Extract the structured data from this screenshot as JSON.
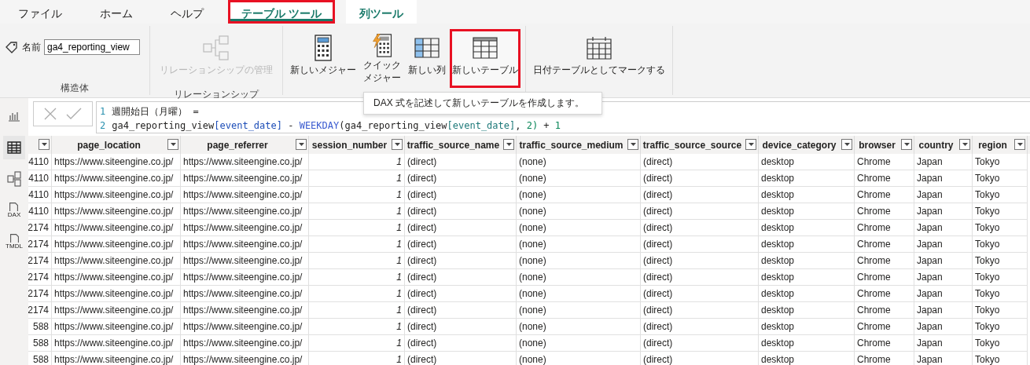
{
  "tabs": [
    {
      "label": "ファイル",
      "selected": false,
      "contextual": false,
      "highlighted": false
    },
    {
      "label": "ホーム",
      "selected": false,
      "contextual": false,
      "highlighted": false
    },
    {
      "label": "ヘルプ",
      "selected": false,
      "contextual": false,
      "highlighted": false
    },
    {
      "label": "テーブル ツール",
      "selected": true,
      "contextual": true,
      "highlighted": true
    },
    {
      "label": "列ツール",
      "selected": false,
      "contextual": true,
      "highlighted": false
    }
  ],
  "ribbon": {
    "groups": [
      {
        "label": "構造体",
        "items": [
          {
            "kind": "name_field",
            "label": "名前",
            "value": "ga4_reporting_view"
          }
        ]
      },
      {
        "label": "リレーションシップ",
        "items": [
          {
            "kind": "relationships",
            "label": "リレーションシップの管理",
            "disabled": true,
            "highlighted": false
          }
        ]
      },
      {
        "items": [
          {
            "kind": "measure",
            "label": "新しいメジャー",
            "disabled": false,
            "highlighted": false
          },
          {
            "kind": "quick_measure",
            "label": "クイックメジャー",
            "disabled": false,
            "highlighted": false
          },
          {
            "kind": "column",
            "label": "新しい列",
            "disabled": false,
            "highlighted": false
          },
          {
            "kind": "table",
            "label": "新しいテーブル",
            "disabled": false,
            "highlighted": true
          }
        ]
      },
      {
        "items": [
          {
            "kind": "calendar",
            "label": "日付テーブルとしてマークする",
            "disabled": false,
            "highlighted": false
          }
        ]
      }
    ]
  },
  "tooltip": "DAX 式を記述して新しいテーブルを作成します。",
  "sidebar": [
    {
      "kind": "report",
      "selected": false
    },
    {
      "kind": "table",
      "selected": true
    },
    {
      "kind": "model",
      "selected": false
    },
    {
      "kind": "dax",
      "label": "DAX",
      "selected": false
    },
    {
      "kind": "tmdl",
      "label": "TMDL",
      "selected": false
    }
  ],
  "formula": {
    "lines": [
      {
        "number": "1",
        "tokens": [
          {
            "kind": "plain",
            "text": "週開始日（月曜） ="
          }
        ]
      },
      {
        "number": "2",
        "tokens": [
          {
            "kind": "plain",
            "text": "ga4_reporting_view"
          },
          {
            "kind": "column",
            "text": "[event_date]"
          },
          {
            "kind": "plain",
            "text": " - "
          },
          {
            "kind": "function",
            "text": "WEEKDAY"
          },
          {
            "kind": "plain",
            "text": "("
          },
          {
            "kind": "plain",
            "text": "ga4_reporting_view"
          },
          {
            "kind": "column2",
            "text": "[event_date]"
          },
          {
            "kind": "plain",
            "text": ", "
          },
          {
            "kind": "number",
            "text": "2)"
          },
          {
            "kind": "plain",
            "text": " + "
          },
          {
            "kind": "number",
            "text": "1"
          }
        ]
      }
    ]
  },
  "table": {
    "columns": [
      null,
      "page_location",
      "page_referrer",
      "session_number",
      "traffic_source_name",
      "traffic_source_medium",
      "traffic_source_source",
      "device_category",
      "browser",
      "country",
      "region"
    ],
    "rows": [
      [
        "4110",
        "https://www.siteengine.co.jp/",
        "https://www.siteengine.co.jp/",
        "1",
        "(direct)",
        "(none)",
        "(direct)",
        "desktop",
        "Chrome",
        "Japan",
        "Tokyo"
      ],
      [
        "4110",
        "https://www.siteengine.co.jp/",
        "https://www.siteengine.co.jp/",
        "1",
        "(direct)",
        "(none)",
        "(direct)",
        "desktop",
        "Chrome",
        "Japan",
        "Tokyo"
      ],
      [
        "4110",
        "https://www.siteengine.co.jp/",
        "https://www.siteengine.co.jp/",
        "1",
        "(direct)",
        "(none)",
        "(direct)",
        "desktop",
        "Chrome",
        "Japan",
        "Tokyo"
      ],
      [
        "4110",
        "https://www.siteengine.co.jp/",
        "https://www.siteengine.co.jp/",
        "1",
        "(direct)",
        "(none)",
        "(direct)",
        "desktop",
        "Chrome",
        "Japan",
        "Tokyo"
      ],
      [
        "2174",
        "https://www.siteengine.co.jp/",
        "https://www.siteengine.co.jp/",
        "1",
        "(direct)",
        "(none)",
        "(direct)",
        "desktop",
        "Chrome",
        "Japan",
        "Tokyo"
      ],
      [
        "2174",
        "https://www.siteengine.co.jp/",
        "https://www.siteengine.co.jp/",
        "1",
        "(direct)",
        "(none)",
        "(direct)",
        "desktop",
        "Chrome",
        "Japan",
        "Tokyo"
      ],
      [
        "2174",
        "https://www.siteengine.co.jp/",
        "https://www.siteengine.co.jp/",
        "1",
        "(direct)",
        "(none)",
        "(direct)",
        "desktop",
        "Chrome",
        "Japan",
        "Tokyo"
      ],
      [
        "2174",
        "https://www.siteengine.co.jp/",
        "https://www.siteengine.co.jp/",
        "1",
        "(direct)",
        "(none)",
        "(direct)",
        "desktop",
        "Chrome",
        "Japan",
        "Tokyo"
      ],
      [
        "2174",
        "https://www.siteengine.co.jp/",
        "https://www.siteengine.co.jp/",
        "1",
        "(direct)",
        "(none)",
        "(direct)",
        "desktop",
        "Chrome",
        "Japan",
        "Tokyo"
      ],
      [
        "2174",
        "https://www.siteengine.co.jp/",
        "https://www.siteengine.co.jp/",
        "1",
        "(direct)",
        "(none)",
        "(direct)",
        "desktop",
        "Chrome",
        "Japan",
        "Tokyo"
      ],
      [
        "588",
        "https://www.siteengine.co.jp/",
        "https://www.siteengine.co.jp/",
        "1",
        "(direct)",
        "(none)",
        "(direct)",
        "desktop",
        "Chrome",
        "Japan",
        "Tokyo"
      ],
      [
        "588",
        "https://www.siteengine.co.jp/",
        "https://www.siteengine.co.jp/",
        "1",
        "(direct)",
        "(none)",
        "(direct)",
        "desktop",
        "Chrome",
        "Japan",
        "Tokyo"
      ],
      [
        "588",
        "https://www.siteengine.co.jp/",
        "https://www.siteengine.co.jp/",
        "1",
        "(direct)",
        "(none)",
        "(direct)",
        "desktop",
        "Chrome",
        "Japan",
        "Tokyo"
      ]
    ]
  }
}
